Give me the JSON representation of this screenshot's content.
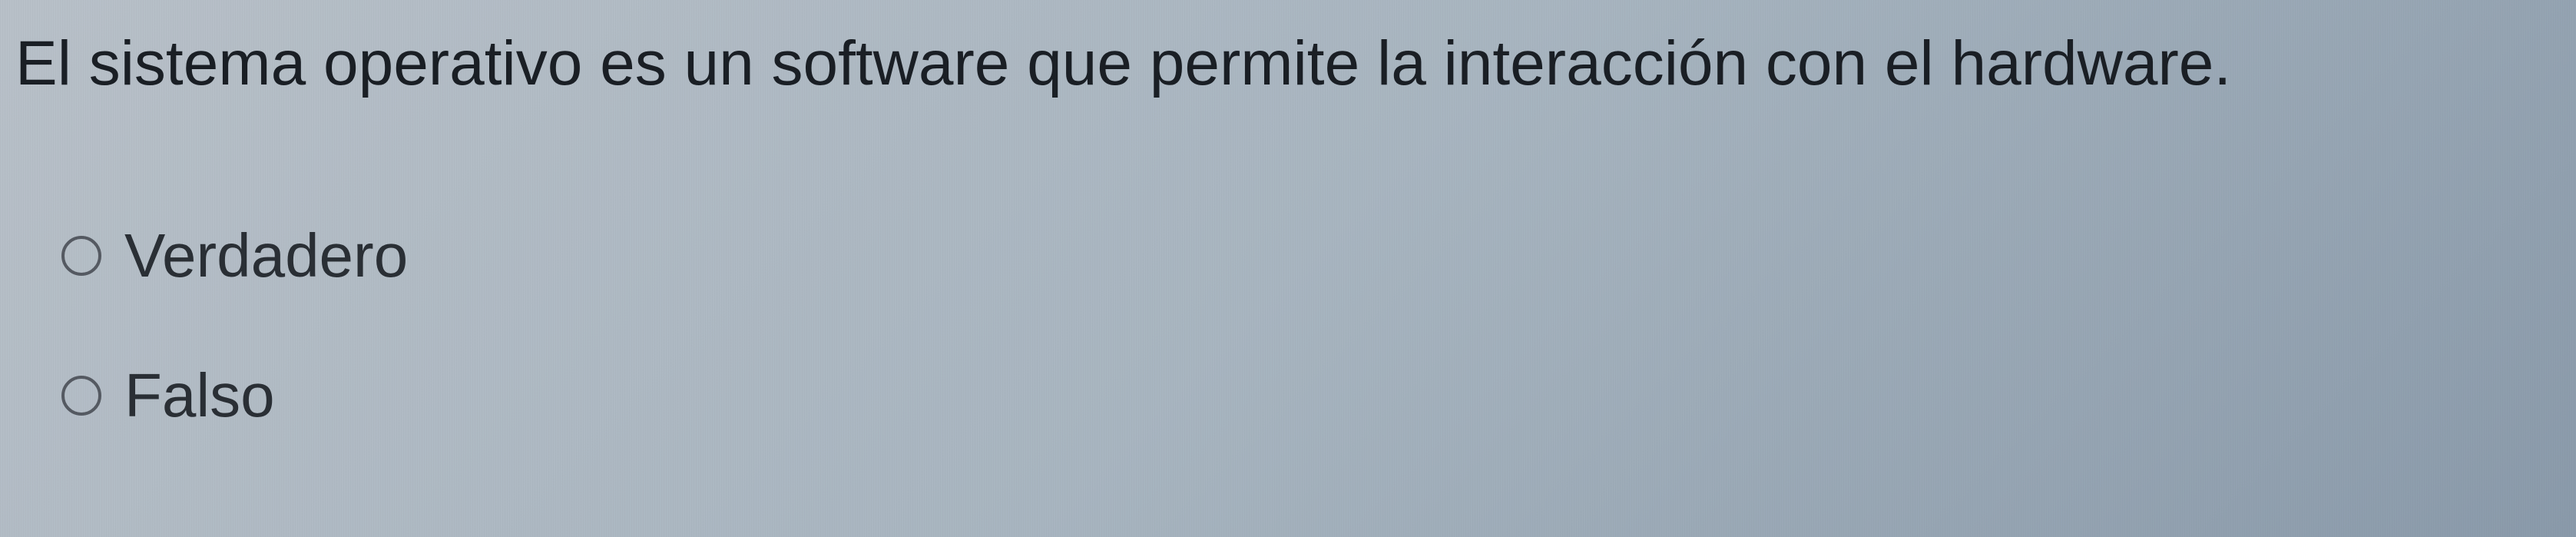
{
  "question": {
    "text": "El sistema operativo es un software que permite la interacción con el hardware."
  },
  "options": [
    {
      "label": "Verdadero",
      "selected": false
    },
    {
      "label": "Falso",
      "selected": false
    }
  ]
}
